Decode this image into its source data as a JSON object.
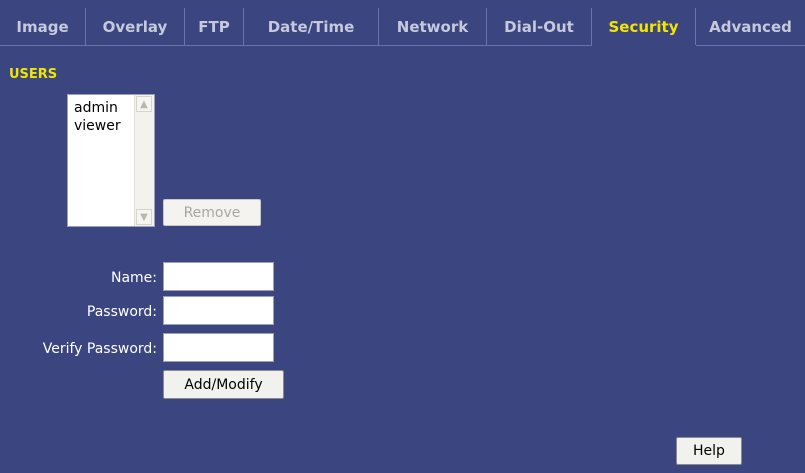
{
  "tabs": [
    {
      "label": "Image",
      "active": false
    },
    {
      "label": "Overlay",
      "active": false
    },
    {
      "label": "FTP",
      "active": false
    },
    {
      "label": "Date/Time",
      "active": false
    },
    {
      "label": "Network",
      "active": false
    },
    {
      "label": "Dial-Out",
      "active": false
    },
    {
      "label": "Security",
      "active": true
    },
    {
      "label": "Advanced",
      "active": false
    }
  ],
  "users_section": {
    "title": "USERS",
    "users": [
      "admin",
      "viewer"
    ],
    "remove_label": "Remove"
  },
  "form": {
    "name_label": "Name:",
    "name_value": "",
    "password_label": "Password:",
    "password_value": "",
    "verify_label": "Verify Password:",
    "verify_value": "",
    "add_modify_label": "Add/Modify"
  },
  "help_label": "Help",
  "colors": {
    "background": "#3b4580",
    "active_tab": "#f2e600",
    "tab_text": "#c6c9dc"
  }
}
